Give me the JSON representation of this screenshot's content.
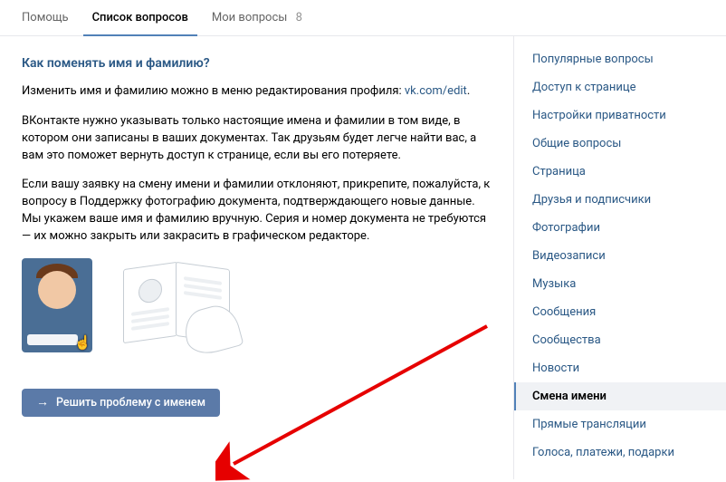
{
  "tabs": {
    "help": "Помощь",
    "questions_list": "Список вопросов",
    "my_questions": "Мои вопросы",
    "my_questions_count": "8"
  },
  "article": {
    "title": "Как поменять имя и фамилию?",
    "p1_a": "Изменить имя и фамилию можно в меню редактирования профиля: ",
    "p1_link": "vk.com/edit",
    "p1_b": ".",
    "p2": "ВКонтакте нужно указывать только настоящие имена и фамилии в том виде, в котором они записаны в ваших документах. Так друзьям будет легче найти вас, а вам это поможет вернуть доступ к странице, если вы его потеряете.",
    "p3": "Если вашу заявку на смену имени и фамилии отклоняют, прикрепите, пожалуйста, к вопросу в Поддержку фотографию документа, подтверждающего новые данные. Мы укажем ваше имя и фамилию вручную. Серия и номер документа не требуются — их можно закрыть или закрасить в графическом редакторе.",
    "cta_label": "Решить проблему с именем"
  },
  "sidebar": {
    "items": [
      "Популярные вопросы",
      "Доступ к странице",
      "Настройки приватности",
      "Общие вопросы",
      "Страница",
      "Друзья и подписчики",
      "Фотографии",
      "Видеозаписи",
      "Музыка",
      "Сообщения",
      "Сообщества",
      "Новости",
      "Смена имени",
      "Прямые трансляции",
      "Голоса, платежи, подарки"
    ],
    "active_index": 12
  }
}
